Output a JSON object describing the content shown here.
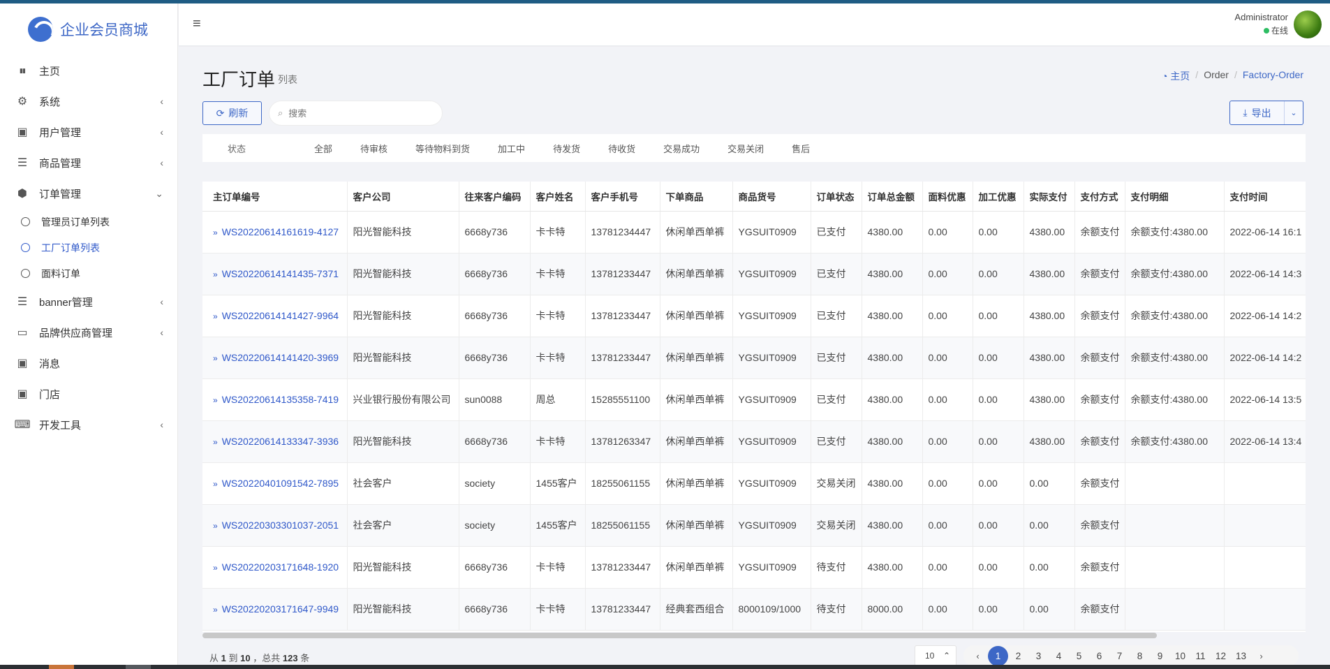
{
  "brand": {
    "name": "企业会员商城"
  },
  "sidebar": {
    "items": [
      {
        "icon": "bar-chart-icon",
        "label": "主页",
        "chevron": ""
      },
      {
        "icon": "gear-icon",
        "label": "系统",
        "chevron": "‹"
      },
      {
        "icon": "user-badge-icon",
        "label": "用户管理",
        "chevron": "‹"
      },
      {
        "icon": "list-icon",
        "label": "商品管理",
        "chevron": "‹"
      },
      {
        "icon": "hexagon-icon",
        "label": "订单管理",
        "chevron": "⌄"
      }
    ],
    "submenu": [
      {
        "label": "管理员订单列表",
        "active": false
      },
      {
        "label": "工厂订单列表",
        "active": true
      },
      {
        "label": "面料订单",
        "active": false
      }
    ],
    "items2": [
      {
        "icon": "database-icon",
        "label": "banner管理",
        "chevron": "‹"
      },
      {
        "icon": "credit-card-icon",
        "label": "品牌供应商管理",
        "chevron": "‹"
      },
      {
        "icon": "user-badge-icon",
        "label": "消息",
        "chevron": ""
      },
      {
        "icon": "user-badge-icon",
        "label": "门店",
        "chevron": ""
      },
      {
        "icon": "keyboard-icon",
        "label": "开发工具",
        "chevron": "‹"
      }
    ]
  },
  "header": {
    "user_name": "Administrator",
    "user_status": "在线"
  },
  "page": {
    "title": "工厂订单",
    "subtitle": "列表"
  },
  "breadcrumb": {
    "home": "主页",
    "level1": "Order",
    "level2": "Factory-Order"
  },
  "toolbar": {
    "refresh_label": "刷新",
    "search_placeholder": "搜索",
    "export_label": "导出"
  },
  "status_filter": {
    "label": "状态",
    "options": [
      "全部",
      "待审核",
      "等待物料到货",
      "加工中",
      "待发货",
      "待收货",
      "交易成功",
      "交易关闭",
      "售后"
    ]
  },
  "table": {
    "columns": [
      "主订单编号",
      "客户公司",
      "往来客户编码",
      "客户姓名",
      "客户手机号",
      "下单商品",
      "商品货号",
      "订单状态",
      "订单总金额",
      "面料优惠",
      "加工优惠",
      "实际支付",
      "支付方式",
      "支付明细",
      "支付时间"
    ],
    "rows": [
      [
        "WS20220614161619-4127",
        "阳光智能科技",
        "6668y736",
        "卡卡特",
        "13781234447",
        "休闲单西单裤",
        "YGSUIT0909",
        "已支付",
        "4380.00",
        "0.00",
        "0.00",
        "4380.00",
        "余额支付",
        "余额支付:4380.00",
        "2022-06-14 16:1"
      ],
      [
        "WS20220614141435-7371",
        "阳光智能科技",
        "6668y736",
        "卡卡特",
        "13781233447",
        "休闲单西单裤",
        "YGSUIT0909",
        "已支付",
        "4380.00",
        "0.00",
        "0.00",
        "4380.00",
        "余额支付",
        "余额支付:4380.00",
        "2022-06-14 14:3"
      ],
      [
        "WS20220614141427-9964",
        "阳光智能科技",
        "6668y736",
        "卡卡特",
        "13781233447",
        "休闲单西单裤",
        "YGSUIT0909",
        "已支付",
        "4380.00",
        "0.00",
        "0.00",
        "4380.00",
        "余额支付",
        "余额支付:4380.00",
        "2022-06-14 14:2"
      ],
      [
        "WS20220614141420-3969",
        "阳光智能科技",
        "6668y736",
        "卡卡特",
        "13781233447",
        "休闲单西单裤",
        "YGSUIT0909",
        "已支付",
        "4380.00",
        "0.00",
        "0.00",
        "4380.00",
        "余额支付",
        "余额支付:4380.00",
        "2022-06-14 14:2"
      ],
      [
        "WS20220614135358-7419",
        "兴业银行股份有限公司",
        "sun0088",
        "周总",
        "15285551100",
        "休闲单西单裤",
        "YGSUIT0909",
        "已支付",
        "4380.00",
        "0.00",
        "0.00",
        "4380.00",
        "余额支付",
        "余额支付:4380.00",
        "2022-06-14 13:5"
      ],
      [
        "WS20220614133347-3936",
        "阳光智能科技",
        "6668y736",
        "卡卡特",
        "13781263347",
        "休闲单西单裤",
        "YGSUIT0909",
        "已支付",
        "4380.00",
        "0.00",
        "0.00",
        "4380.00",
        "余额支付",
        "余额支付:4380.00",
        "2022-06-14 13:4"
      ],
      [
        "WS20220401091542-7895",
        "社会客户",
        "society",
        "1455客户",
        "18255061155",
        "休闲单西单裤",
        "YGSUIT0909",
        "交易关闭",
        "4380.00",
        "0.00",
        "0.00",
        "0.00",
        "余额支付",
        "",
        ""
      ],
      [
        "WS20220303301037-2051",
        "社会客户",
        "society",
        "1455客户",
        "18255061155",
        "休闲单西单裤",
        "YGSUIT0909",
        "交易关闭",
        "4380.00",
        "0.00",
        "0.00",
        "0.00",
        "余额支付",
        "",
        ""
      ],
      [
        "WS20220203171648-1920",
        "阳光智能科技",
        "6668y736",
        "卡卡特",
        "13781233447",
        "休闲单西单裤",
        "YGSUIT0909",
        "待支付",
        "4380.00",
        "0.00",
        "0.00",
        "0.00",
        "余额支付",
        "",
        ""
      ],
      [
        "WS20220203171647-9949",
        "阳光智能科技",
        "6668y736",
        "卡卡特",
        "13781233447",
        "经典套西组合",
        "8000109/1000",
        "待支付",
        "8000.00",
        "0.00",
        "0.00",
        "0.00",
        "余额支付",
        "",
        ""
      ]
    ]
  },
  "footer": {
    "range_from_label": "从",
    "range_start": "1",
    "range_to_label": "到",
    "range_end": "10",
    "total_label": "，总共",
    "total": "123",
    "unit": "条",
    "page_size": "10",
    "pages": [
      "1",
      "2",
      "3",
      "4",
      "5",
      "6",
      "7",
      "8",
      "9",
      "10",
      "11",
      "12",
      "13"
    ],
    "current_page": "1",
    "prev": "‹",
    "next": "›"
  }
}
